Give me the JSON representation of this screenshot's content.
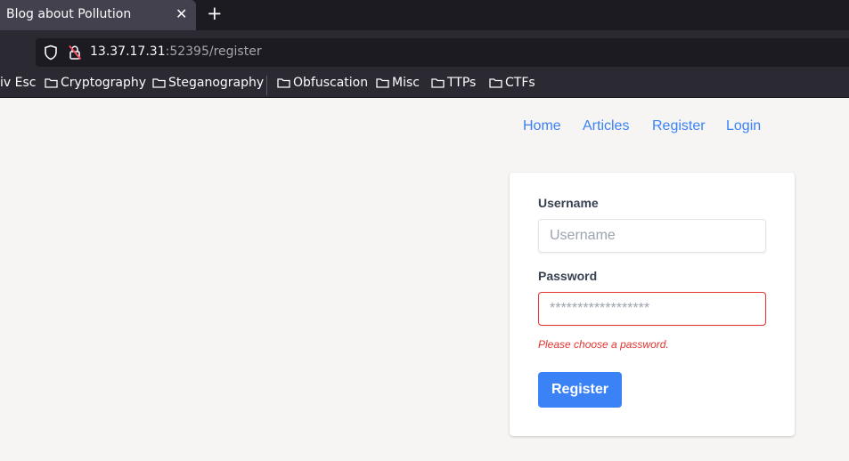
{
  "browser": {
    "tab_title": "Blog about Pollution",
    "tab_close": "✕",
    "new_tab": "+",
    "url_host": "13.37.17.31",
    "url_path": ":52395/register",
    "bookmarks": [
      "iv Esc",
      "Cryptography",
      "Steganography",
      "Obfuscation",
      "Misc",
      "TTPs",
      "CTFs"
    ]
  },
  "site_nav": {
    "home": "Home",
    "articles": "Articles",
    "register": "Register",
    "login": "Login"
  },
  "form": {
    "username_label": "Username",
    "username_placeholder": "Username",
    "password_label": "Password",
    "password_placeholder": "******************",
    "password_error": "Please choose a password.",
    "submit_label": "Register"
  },
  "colors": {
    "link": "#3b82f6",
    "button": "#3b82f6",
    "error": "#e3342f"
  }
}
